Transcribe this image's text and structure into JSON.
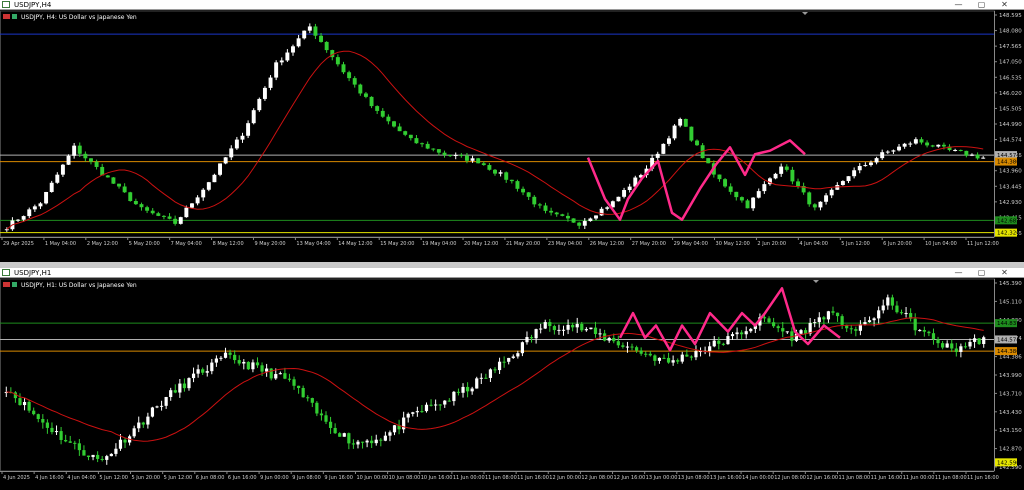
{
  "colors": {
    "bg": "#000000",
    "bull": "#ffffff",
    "bear": "#32cd32",
    "ma": "#cc1111",
    "pink": "#ff2a8a",
    "hl_dark_green": "#1e8c1e",
    "hl_orange": "#d98a00",
    "hl_white": "#b0b0b0",
    "hl_yellow": "#e6e600",
    "hl_blue": "#1a35c8",
    "axis_text": "#cfcfcf"
  },
  "icons": {
    "window_icon": "chart-window-icon",
    "minimize": "minimize-icon",
    "maximize": "maximize-icon",
    "close": "close-icon"
  },
  "windows": [
    {
      "id": "h4",
      "title": "USDJPY,H4",
      "label": "USDJPY, H4: US Dollar vs Japanese Yen",
      "controls": {
        "minimize": "—",
        "maximize": "▢",
        "close": "✕"
      },
      "price_axis": [
        "148.595",
        "148.080",
        "147.565",
        "147.050",
        "146.535",
        "146.020",
        "145.505",
        "144.990",
        "144.574",
        "144.386",
        "143.960",
        "143.445",
        "142.930",
        "142.415",
        "142.326"
      ],
      "price_labels_highlight": [
        {
          "text": "144.574",
          "color": "hl_white",
          "level": 144.574
        },
        {
          "text": "144.386",
          "color": "hl_orange",
          "level": 144.386
        },
        {
          "text": "142.683",
          "color": "hl_dark_green",
          "level": 142.683
        },
        {
          "text": "142.326",
          "color": "hl_yellow",
          "level": 142.326
        }
      ],
      "hlines": [
        {
          "level": 148.08,
          "color": "hl_blue"
        },
        {
          "level": 144.574,
          "color": "hl_white"
        },
        {
          "level": 144.386,
          "color": "hl_orange"
        },
        {
          "level": 142.683,
          "color": "hl_dark_green"
        },
        {
          "level": 142.326,
          "color": "hl_yellow"
        }
      ],
      "time_axis": [
        "29 Apr 2025",
        "1 May 04:00",
        "2 May 12:00",
        "5 May 20:00",
        "7 May 04:00",
        "8 May 12:00",
        "9 May 20:00",
        "13 May 04:00",
        "14 May 12:00",
        "15 May 20:00",
        "19 May 04:00",
        "20 May 12:00",
        "21 May 20:00",
        "23 May 04:00",
        "26 May 12:00",
        "27 May 20:00",
        "29 May 04:00",
        "30 May 12:00",
        "2 Jun 20:00",
        "4 Jun 04:00",
        "5 Jun 12:00",
        "6 Jun 20:00",
        "10 Jun 04:00",
        "11 Jun 12:00"
      ]
    },
    {
      "id": "h1",
      "title": "USDJPY,H1",
      "label": "USDJPY, H1: US Dollar vs Japanese Yen",
      "controls": {
        "minimize": "—",
        "maximize": "▢",
        "close": "✕"
      },
      "price_axis": [
        "145.390",
        "145.110",
        "144.830",
        "144.574",
        "144.386",
        "143.990",
        "143.710",
        "143.430",
        "143.150",
        "142.870",
        "142.590"
      ],
      "price_labels_highlight": [
        {
          "text": "144.837",
          "color": "hl_dark_green",
          "level": 144.837
        },
        {
          "text": "144.574",
          "color": "hl_white",
          "level": 144.574
        },
        {
          "text": "144.386",
          "color": "hl_orange",
          "level": 144.386
        },
        {
          "text": "142.590",
          "color": "hl_yellow",
          "level": 142.59
        }
      ],
      "hlines": [
        {
          "level": 144.837,
          "color": "hl_dark_green"
        },
        {
          "level": 144.574,
          "color": "hl_white"
        },
        {
          "level": 144.386,
          "color": "hl_orange"
        }
      ],
      "time_axis": [
        "4 Jun 2025",
        "4 Jun 16:00",
        "4 Jun 04:00",
        "5 Jun 12:00",
        "5 Jun 20:00",
        "5 Jun 12:00",
        "6 Jun 08:00",
        "6 Jun 16:00",
        "9 Jun 00:00",
        "9 Jun 08:00",
        "9 Jun 16:00",
        "10 Jun 00:00",
        "10 Jun 08:00",
        "10 Jun 16:00",
        "11 Jun 00:00",
        "11 Jun 08:00",
        "11 Jun 16:00",
        "12 Jun 00:00",
        "12 Jun 08:00",
        "12 Jun 16:00",
        "13 Jun 00:00",
        "13 Jun 08:00",
        "13 Jun 16:00",
        "14 Jun 00:00",
        "12 Jun 08:00",
        "12 Jun 16:00",
        "11 Jun 08:00",
        "11 Jun 16:00",
        "11 Jun 00:00",
        "11 Jun 08:00",
        "11 Jun 16:00"
      ]
    }
  ]
}
